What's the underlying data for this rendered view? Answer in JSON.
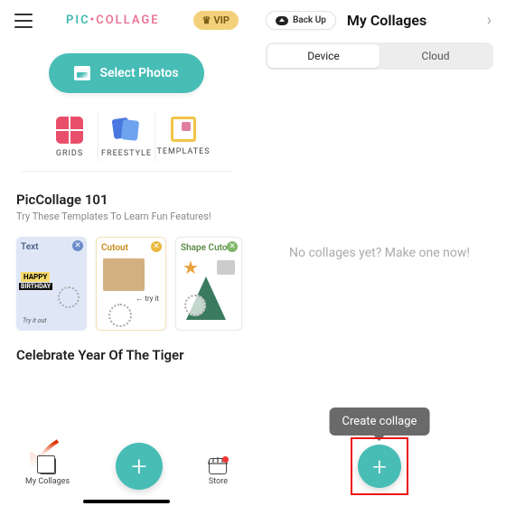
{
  "left": {
    "brand_pic": "PIC",
    "brand_collage": "COLLAGE",
    "vip": "VIP",
    "select_photos": "Select Photos",
    "modes": {
      "grids": "GRIDS",
      "freestyle": "FREESTYLE",
      "templates": "TEMPLATES"
    },
    "section101": {
      "title": "PicCollage 101",
      "subtitle": "Try These Templates To Learn Fun Features!"
    },
    "cards": {
      "text": {
        "label": "Text",
        "tag1": "HAPPY",
        "tag2": "BIRTHDAY",
        "note": "Try it out"
      },
      "cutout": {
        "label": "Cutout",
        "arrow": "← try it"
      },
      "shapecutout": {
        "label": "Shape Cutout"
      }
    },
    "celebrate_title": "Celebrate Year Of The Tiger",
    "bottom": {
      "my_collages": "My Collages",
      "store": "Store"
    }
  },
  "right": {
    "backup": "Back Up",
    "title": "My Collages",
    "tabs": {
      "device": "Device",
      "cloud": "Cloud"
    },
    "empty": "No collages yet? Make one now!",
    "tooltip": "Create collage"
  }
}
